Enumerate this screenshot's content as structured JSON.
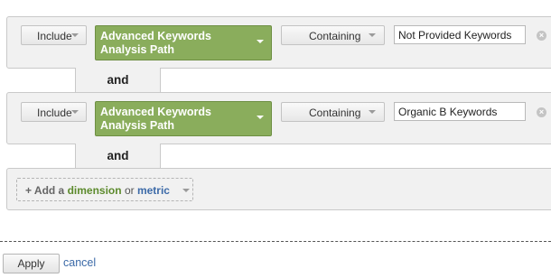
{
  "conditions": [
    {
      "include_label": "Include",
      "dimension_label": "Advanced Keywords Analysis Path",
      "match_label": "Containing",
      "value": "Not Provided Keywords"
    },
    {
      "include_label": "Include",
      "dimension_label": "Advanced Keywords Analysis Path",
      "match_label": "Containing",
      "value": "Organic B Keywords"
    }
  ],
  "connectors": [
    "and",
    "and"
  ],
  "add_button": {
    "prefix": "+ Add a",
    "dimension_word": "dimension",
    "or_word": "or",
    "metric_word": "metric"
  },
  "footer": {
    "apply_label": "Apply",
    "cancel_label": "cancel"
  },
  "colors": {
    "dimension_chip": "#8aad5c",
    "dimension_text": "#5c8a2c",
    "metric_text": "#3c6aa8",
    "link": "#3c6aa8"
  }
}
